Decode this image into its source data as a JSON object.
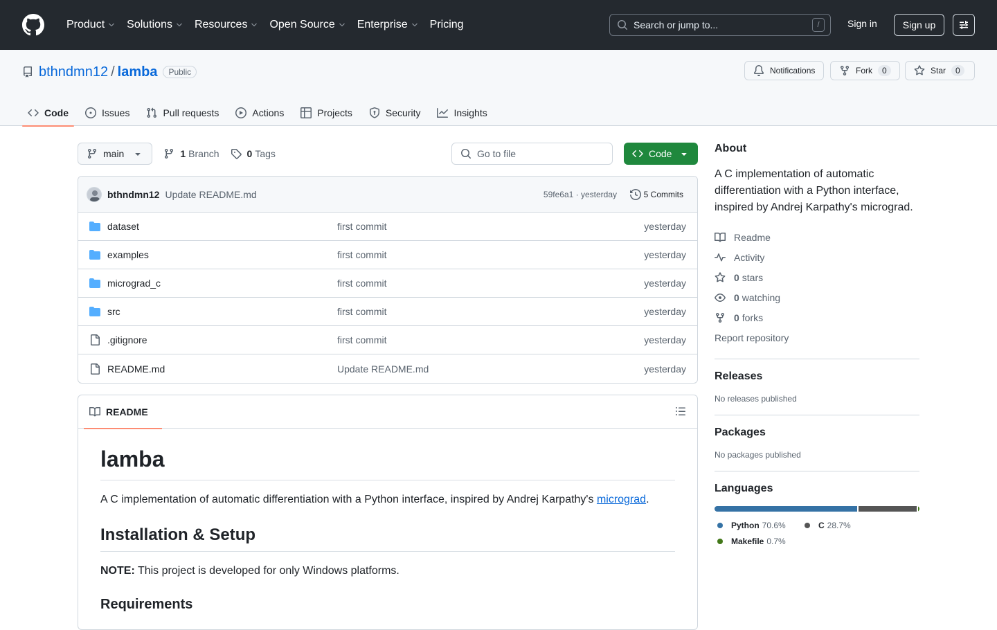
{
  "header": {
    "nav": [
      {
        "label": "Product",
        "dropdown": true
      },
      {
        "label": "Solutions",
        "dropdown": true
      },
      {
        "label": "Resources",
        "dropdown": true
      },
      {
        "label": "Open Source",
        "dropdown": true
      },
      {
        "label": "Enterprise",
        "dropdown": true
      },
      {
        "label": "Pricing",
        "dropdown": false
      }
    ],
    "search_placeholder": "Search or jump to...",
    "search_shortcut": "/",
    "sign_in": "Sign in",
    "sign_up": "Sign up"
  },
  "repo": {
    "owner": "bthndmn12",
    "separator": "/",
    "name": "lamba",
    "visibility": "Public",
    "notifications_label": "Notifications",
    "fork_label": "Fork",
    "fork_count": "0",
    "star_label": "Star",
    "star_count": "0"
  },
  "tabs": [
    {
      "label": "Code",
      "icon": "code-icon",
      "selected": true
    },
    {
      "label": "Issues",
      "icon": "issue-icon",
      "selected": false
    },
    {
      "label": "Pull requests",
      "icon": "pull-request-icon",
      "selected": false
    },
    {
      "label": "Actions",
      "icon": "play-icon",
      "selected": false
    },
    {
      "label": "Projects",
      "icon": "table-icon",
      "selected": false
    },
    {
      "label": "Security",
      "icon": "shield-icon",
      "selected": false
    },
    {
      "label": "Insights",
      "icon": "graph-icon",
      "selected": false
    }
  ],
  "toolbar": {
    "branch": "main",
    "branch_count": "1",
    "branch_label": "Branch",
    "tag_count": "0",
    "tag_label": "Tags",
    "goto_placeholder": "Go to file",
    "code_button": "Code"
  },
  "commit": {
    "author": "bthndmn12",
    "message": "Update README.md",
    "sha_time": "59fe6a1 · yesterday",
    "count_label": "5 Commits"
  },
  "files": [
    {
      "name": "dataset",
      "type": "dir",
      "commit": "first commit",
      "date": "yesterday"
    },
    {
      "name": "examples",
      "type": "dir",
      "commit": "first commit",
      "date": "yesterday"
    },
    {
      "name": "micrograd_c",
      "type": "dir",
      "commit": "first commit",
      "date": "yesterday"
    },
    {
      "name": "src",
      "type": "dir",
      "commit": "first commit",
      "date": "yesterday"
    },
    {
      "name": ".gitignore",
      "type": "file",
      "commit": "first commit",
      "date": "yesterday"
    },
    {
      "name": "README.md",
      "type": "file",
      "commit": "Update README.md",
      "date": "yesterday"
    }
  ],
  "readme": {
    "tab_label": "README",
    "title": "lamba",
    "intro_before": "A C implementation of automatic differentiation with a Python interface, inspired by Andrej Karpathy's ",
    "intro_link": "micrograd",
    "intro_after": ".",
    "h2_install": "Installation & Setup",
    "note_bold": "NOTE:",
    "note_text": " This project is developed for only Windows platforms.",
    "h3_requirements": "Requirements"
  },
  "about": {
    "heading": "About",
    "description": "A C implementation of automatic differentiation with a Python interface, inspired by Andrej Karpathy's micrograd.",
    "readme": "Readme",
    "activity": "Activity",
    "stars_count": "0",
    "stars_label": "stars",
    "watching_count": "0",
    "watching_label": "watching",
    "forks_count": "0",
    "forks_label": "forks",
    "report": "Report repository"
  },
  "releases": {
    "heading": "Releases",
    "note": "No releases published"
  },
  "packages": {
    "heading": "Packages",
    "note": "No packages published"
  },
  "languages": {
    "heading": "Languages",
    "items": [
      {
        "name": "Python",
        "percent": "70.6%",
        "value": 70.6,
        "color": "#3572A5"
      },
      {
        "name": "C",
        "percent": "28.7%",
        "value": 28.7,
        "color": "#555555"
      },
      {
        "name": "Makefile",
        "percent": "0.7%",
        "value": 0.7,
        "color": "#427819"
      }
    ]
  },
  "colors": {
    "header_bg": "#24292f",
    "link": "#0969da",
    "primary_button": "#1f883d",
    "tab_underline": "#fd8c73",
    "folder": "#54aeff"
  }
}
